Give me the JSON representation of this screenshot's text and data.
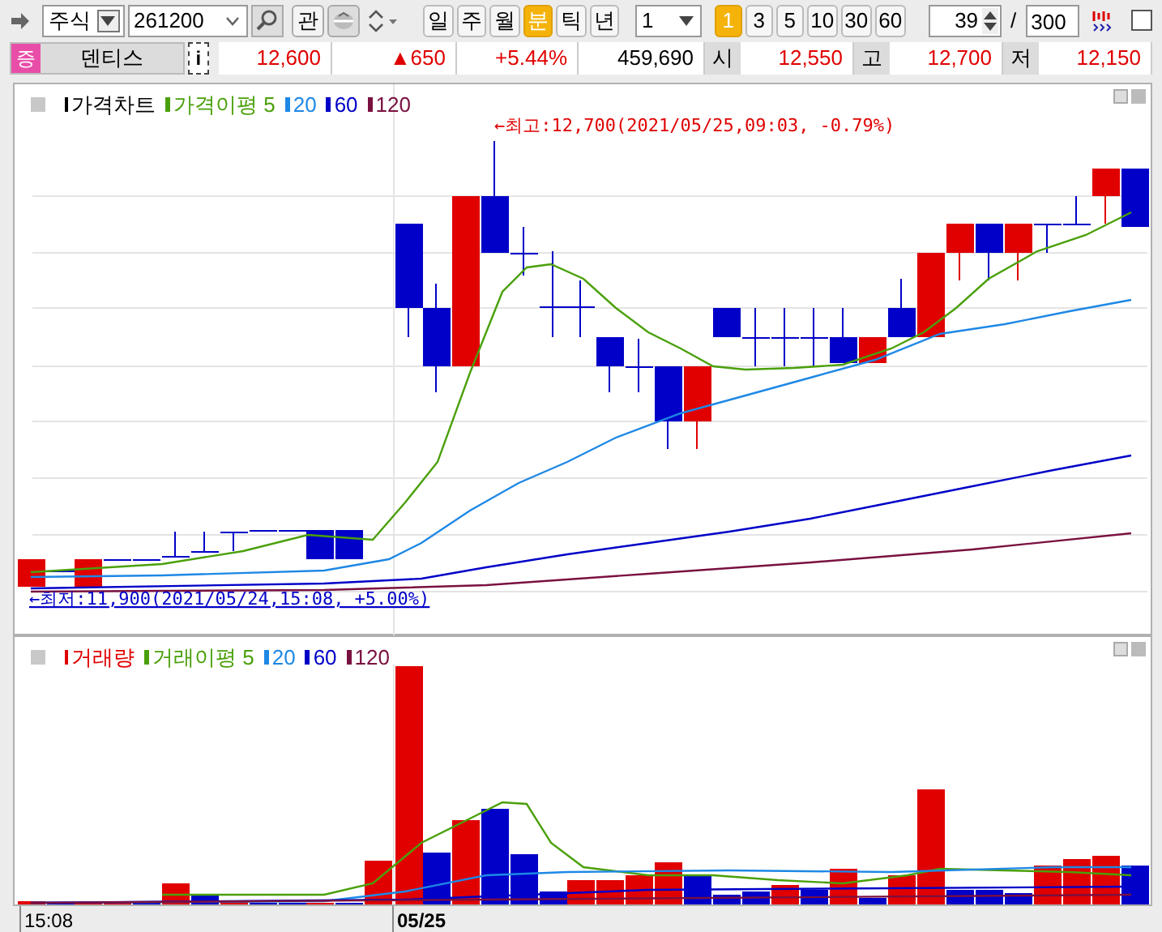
{
  "toolbar": {
    "market": "주식",
    "code": "261200",
    "watch_button": "관",
    "intervals": [
      {
        "label": "일",
        "selected": false
      },
      {
        "label": "주",
        "selected": false
      },
      {
        "label": "월",
        "selected": false
      },
      {
        "label": "분",
        "selected": true
      },
      {
        "label": "틱",
        "selected": false
      },
      {
        "label": "년",
        "selected": false
      }
    ],
    "unit": "1",
    "periods": [
      {
        "label": "1",
        "selected": true
      },
      {
        "label": "3",
        "selected": false
      },
      {
        "label": "5",
        "selected": false
      },
      {
        "label": "10",
        "selected": false
      },
      {
        "label": "30",
        "selected": false
      },
      {
        "label": "60",
        "selected": false
      }
    ],
    "count": "39",
    "separator": "/",
    "max": "300",
    "checked": false
  },
  "quote": {
    "badge": "증",
    "name": "덴티스",
    "info_button": "i",
    "price": "12,600",
    "change": "▲650",
    "rate": "+5.44%",
    "volume": "459,690",
    "fields": [
      {
        "label": "시",
        "value": "12,550"
      },
      {
        "label": "고",
        "value": "12,700"
      },
      {
        "label": "저",
        "value": "12,150"
      }
    ]
  },
  "price_chart": {
    "title": "가격차트",
    "legend": [
      {
        "label": "가격이평 5",
        "color": "#4aa00a"
      },
      {
        "label": "20",
        "color": "#1e88e5"
      },
      {
        "label": "60",
        "color": "#0000c8"
      },
      {
        "label": "120",
        "color": "#7a1040"
      }
    ],
    "high_note": "←최고:12,700(2021/05/25,09:03, -0.79%)",
    "low_note": "←최저:11,900(2021/05/24,15:08, +5.00%)"
  },
  "volume_chart": {
    "title": "거래량",
    "legend": [
      {
        "label": "거래이평 5",
        "color": "#4aa00a"
      },
      {
        "label": "20",
        "color": "#1e88e5"
      },
      {
        "label": "60",
        "color": "#0000c8"
      },
      {
        "label": "120",
        "color": "#7a1040"
      }
    ]
  },
  "x_axis": [
    "15:08",
    "05/25"
  ]
}
